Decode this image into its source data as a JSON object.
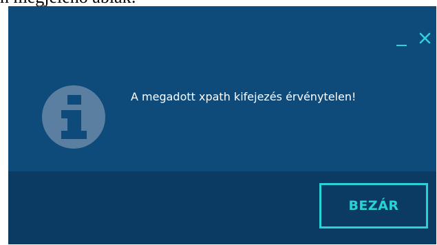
{
  "caption": {
    "text": "n megjelenő ablak:"
  },
  "dialog": {
    "minimize_icon": "minimize-icon",
    "close_icon": "close-icon",
    "info_icon": "info-icon",
    "message": "A megadott xpath kifejezés érvénytelen!",
    "close_button_label": "BEZÁR"
  },
  "colors": {
    "dialog_background": "#0e4a7a",
    "footer_background": "#0b3b63",
    "accent": "#27d3d6",
    "icon_circle": "#5a7fa0"
  }
}
